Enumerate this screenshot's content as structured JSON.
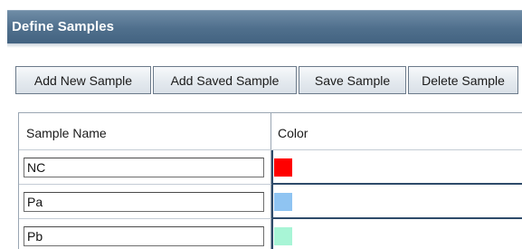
{
  "panel": {
    "title": "Define Samples"
  },
  "toolbar": {
    "add_new_label": "Add New Sample",
    "add_saved_label": "Add Saved Sample",
    "save_label": "Save Sample",
    "delete_label": "Delete Sample"
  },
  "table": {
    "columns": [
      "Sample Name",
      "Color"
    ],
    "rows": [
      {
        "name": "NC",
        "color": "#ff0000"
      },
      {
        "name": "Pa",
        "color": "#8fc4f2"
      },
      {
        "name": "Pb",
        "color": "#a8f5d6"
      }
    ]
  },
  "colors": {
    "title_bar": "#4f6f8c",
    "title_text": "#ffffff",
    "accent_border": "#2e4b6a"
  }
}
